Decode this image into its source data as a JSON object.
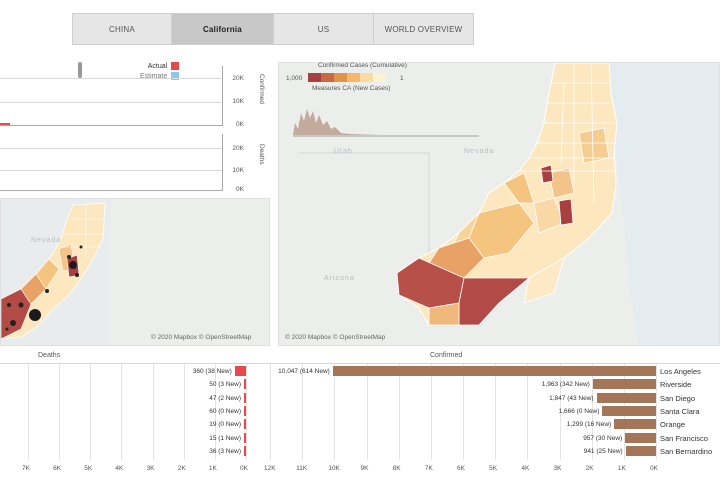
{
  "tabs": [
    {
      "id": "tab-china",
      "label": "CHINA",
      "active": false
    },
    {
      "id": "tab-california",
      "label": "California",
      "active": true
    },
    {
      "id": "tab-us",
      "label": "US",
      "active": false
    },
    {
      "id": "tab-world",
      "label": "WORLD OVERVIEW",
      "active": false
    }
  ],
  "map_main": {
    "attribution": "© 2020 Mapbox © OpenStreetMap",
    "state_labels": [
      "Nevada",
      "Arizona",
      "Utah"
    ]
  },
  "map_small": {
    "attribution": "© 2020 Mapbox © OpenStreetMap",
    "state_labels": [
      "Nevada"
    ]
  },
  "legend": {
    "title": "Confirmed Cases (Cumulative)",
    "min": "1",
    "max": "1,000",
    "subtitle": "Measures CA (New Cases)",
    "colors": [
      "#fdf2d6",
      "#fbdba2",
      "#f6b868",
      "#e0934f",
      "#c46b45",
      "#a84042"
    ]
  },
  "line_charts": {
    "legend": {
      "actual": "Actual",
      "estimate": "Estimate",
      "actual_color": "#e8474c",
      "estimate_color": "#8ec7ee"
    },
    "chart1": {
      "ylabel": "Confirmed",
      "ticks": [
        "20K",
        "10K",
        "0K"
      ]
    },
    "chart2": {
      "ylabel": "Deaths",
      "ticks": [
        "20K",
        "10K",
        "0K"
      ]
    }
  },
  "bar_headers": {
    "confirmed": "Confirmed",
    "deaths": "Deaths"
  },
  "counties": [
    {
      "name": "Los Angeles",
      "confirmed": 10047,
      "confirmed_label": "10,047 (614 New)",
      "deaths": 360,
      "deaths_label": "360 (38 New)"
    },
    {
      "name": "Riverside",
      "confirmed": 1963,
      "confirmed_label": "1,963 (342 New)",
      "deaths": 50,
      "deaths_label": "50 (3 New)"
    },
    {
      "name": "San Diego",
      "confirmed": 1847,
      "confirmed_label": "1,847 (43 New)",
      "deaths": 47,
      "deaths_label": "47 (2 New)"
    },
    {
      "name": "Santa Clara",
      "confirmed": 1666,
      "confirmed_label": "1,666 (0 New)",
      "deaths": 60,
      "deaths_label": "60 (0 New)"
    },
    {
      "name": "Orange",
      "confirmed": 1299,
      "confirmed_label": "1,299 (16 New)",
      "deaths": 19,
      "deaths_label": "19 (0 New)"
    },
    {
      "name": "San Francisco",
      "confirmed": 957,
      "confirmed_label": "957 (30 New)",
      "deaths": 15,
      "deaths_label": "15 (1 New)"
    },
    {
      "name": "San Bernardino",
      "confirmed": 941,
      "confirmed_label": "941 (25 New)",
      "deaths": 36,
      "deaths_label": "36 (3 New)"
    }
  ],
  "axis_confirmed": [
    "0K",
    "1K",
    "2K",
    "3K",
    "4K",
    "5K",
    "6K",
    "7K",
    "8K",
    "9K",
    "10K",
    "11K",
    "12K"
  ],
  "axis_deaths": [
    "0K",
    "1K",
    "2K",
    "3K",
    "4K",
    "5K",
    "6K",
    "7K"
  ],
  "colors": {
    "confirmed_bar": "#a57557",
    "deaths_bar": "#e8474c"
  }
}
